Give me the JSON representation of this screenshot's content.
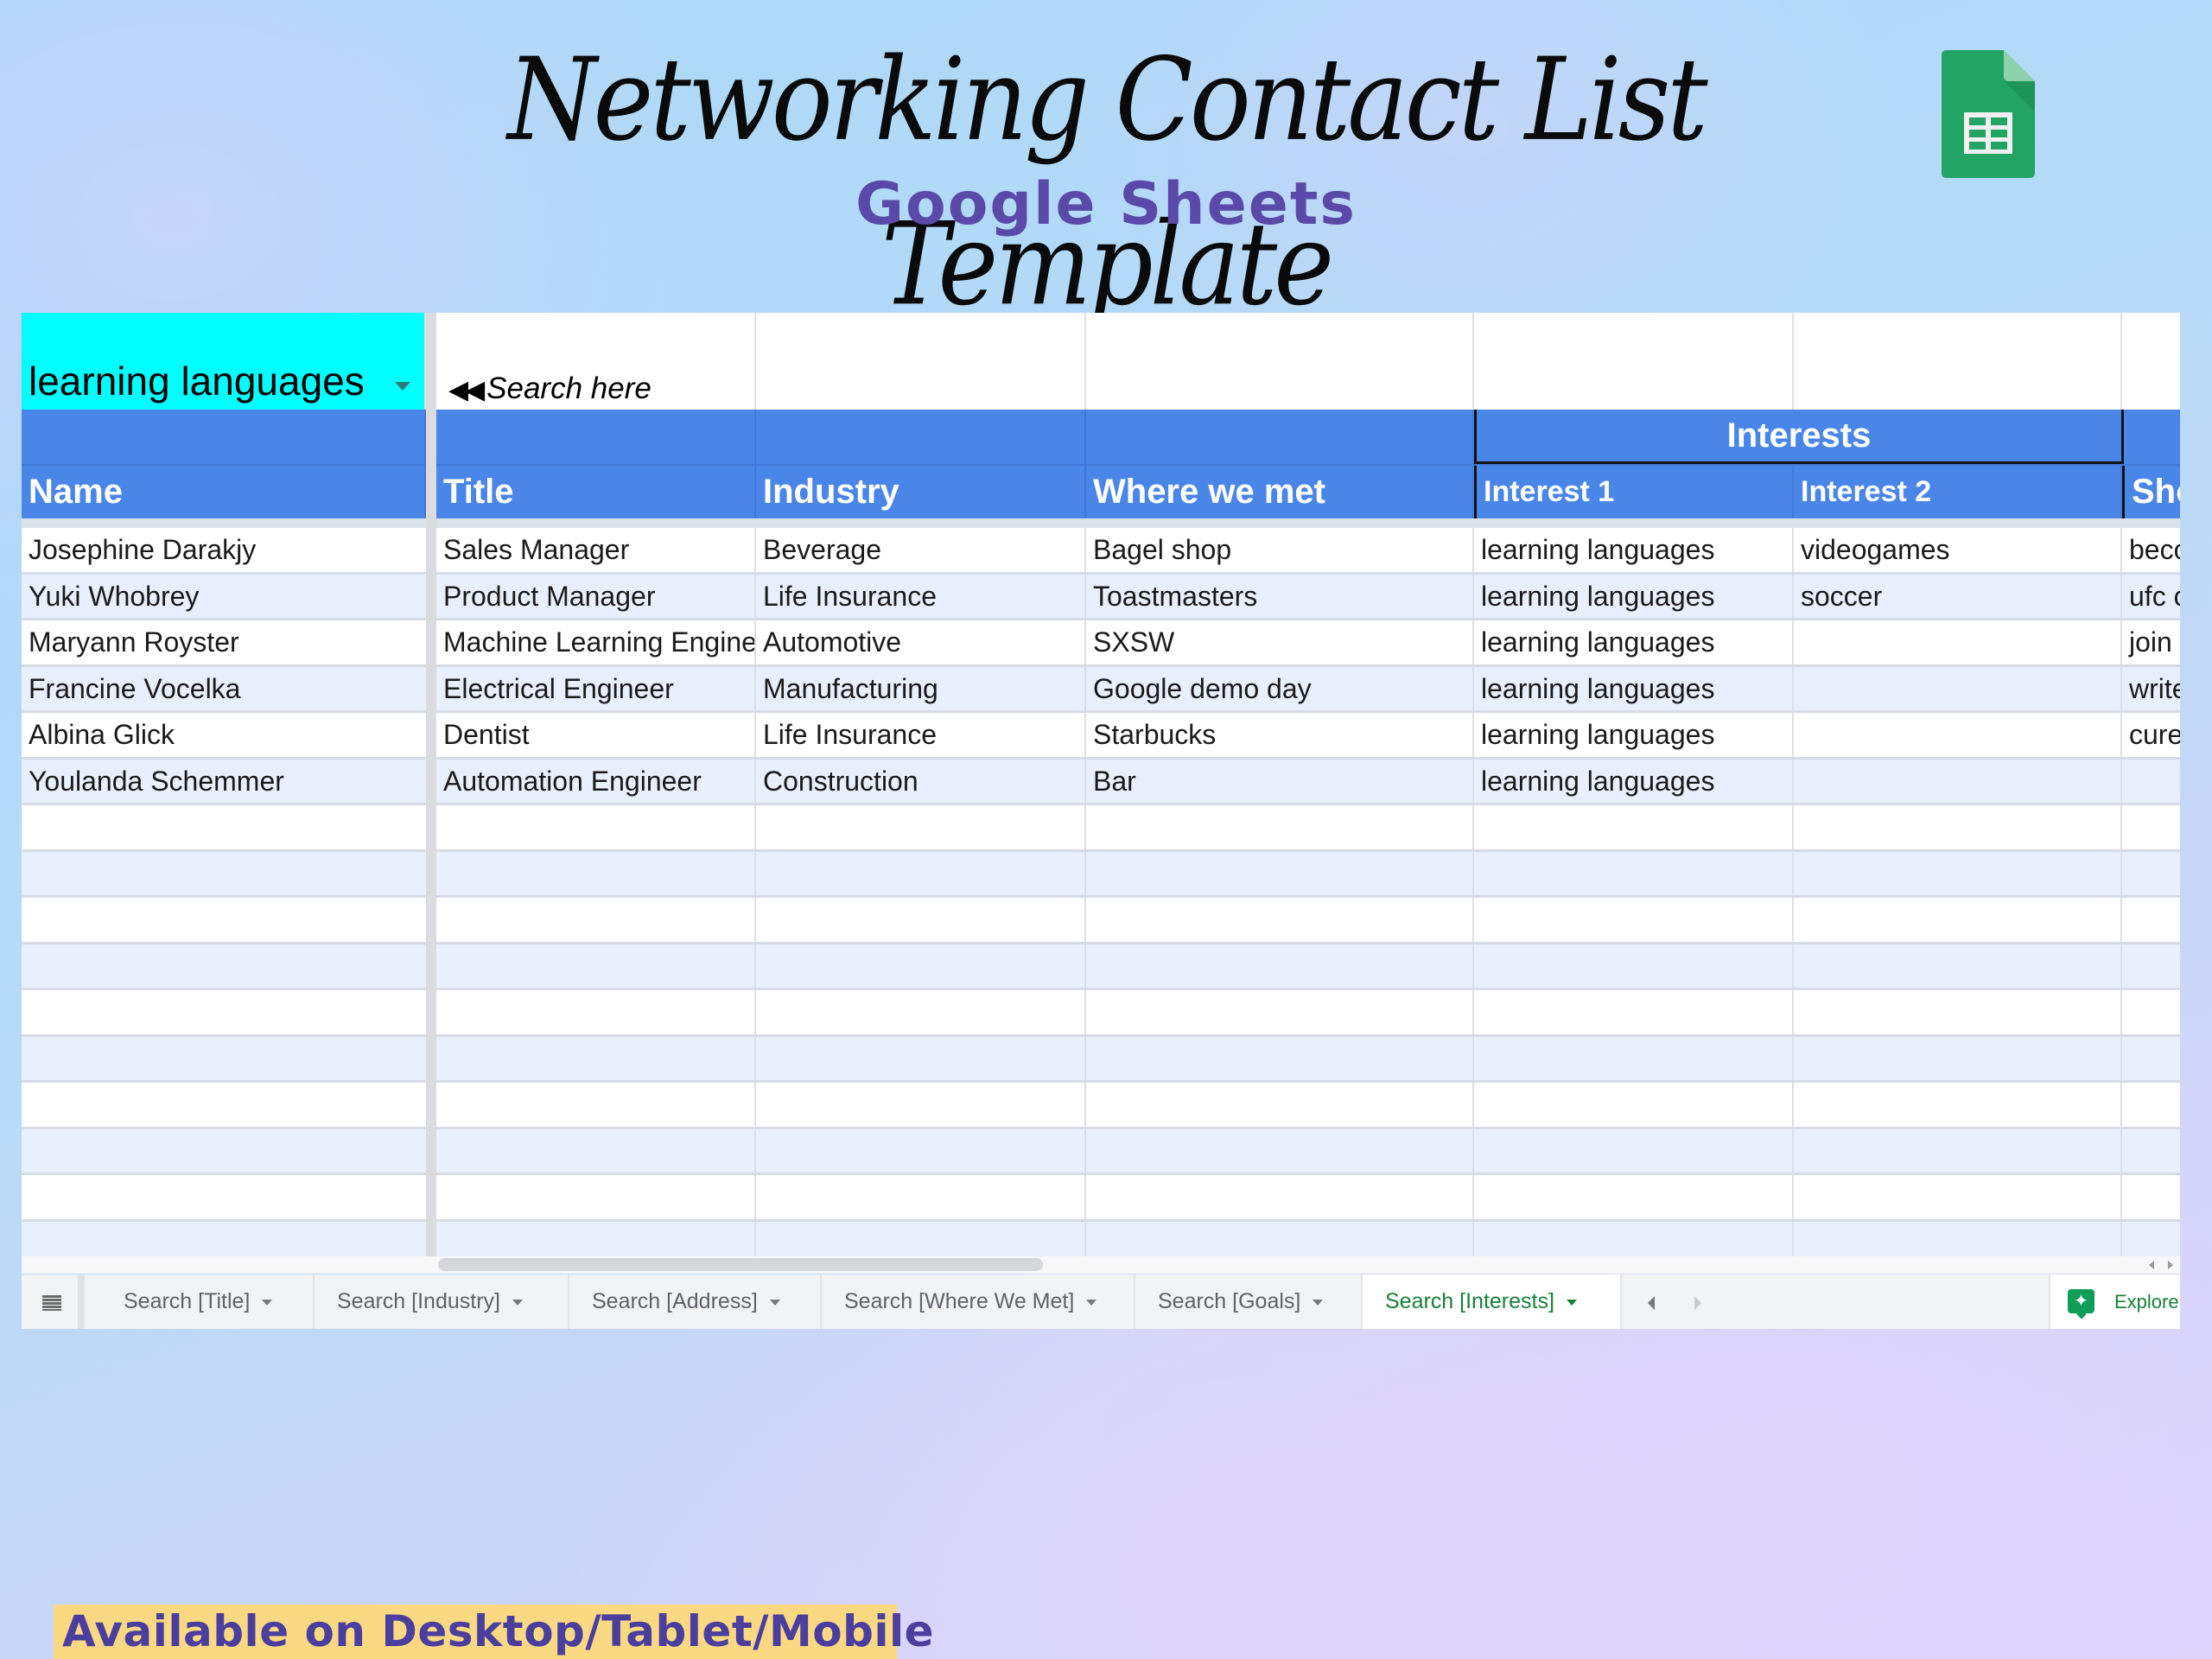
{
  "header": {
    "title": "Networking Contact List Template",
    "subtitle": "Google Sheets",
    "logo_icon": "google-sheets-icon"
  },
  "colors": {
    "filter_cell": "#00ffff",
    "header_blue": "#4a86e8",
    "band_light": "#e8f0fd",
    "active_tab_green": "#188038",
    "subtitle_purple": "#5a49a8",
    "banner_yellow": "#fbd982"
  },
  "filter": {
    "value": "learning languages",
    "hint_arrows": "◀◀",
    "hint": "Search here"
  },
  "table": {
    "group_header": "Interests",
    "columns": [
      "Name",
      "Title",
      "Industry",
      "Where we met",
      "Interest 1",
      "Interest 2",
      "Sho"
    ],
    "rows": [
      [
        "Josephine Darakjy",
        "Sales Manager",
        "Beverage",
        "Bagel shop",
        "learning languages",
        "videogames",
        "beco"
      ],
      [
        "Yuki Whobrey",
        "Product Manager",
        "Life Insurance",
        "Toastmasters",
        "learning languages",
        "soccer",
        "ufc c"
      ],
      [
        "Maryann Royster",
        "Machine Learning Engineer",
        "Automotive",
        "SXSW",
        "learning languages",
        "",
        "join a"
      ],
      [
        "Francine Vocelka",
        "Electrical Engineer",
        "Manufacturing",
        "Google demo day",
        "learning languages",
        "",
        "write"
      ],
      [
        "Albina Glick",
        "Dentist",
        "Life Insurance",
        "Starbucks",
        "learning languages",
        "",
        "cure"
      ],
      [
        "Youlanda Schemmer",
        "Automation Engineer",
        "Construction",
        "Bar",
        "learning languages",
        "",
        ""
      ],
      [
        "",
        "",
        "",
        "",
        "",
        "",
        ""
      ],
      [
        "",
        "",
        "",
        "",
        "",
        "",
        ""
      ],
      [
        "",
        "",
        "",
        "",
        "",
        "",
        ""
      ],
      [
        "",
        "",
        "",
        "",
        "",
        "",
        ""
      ],
      [
        "",
        "",
        "",
        "",
        "",
        "",
        ""
      ],
      [
        "",
        "",
        "",
        "",
        "",
        "",
        ""
      ],
      [
        "",
        "",
        "",
        "",
        "",
        "",
        ""
      ],
      [
        "",
        "",
        "",
        "",
        "",
        "",
        ""
      ],
      [
        "",
        "",
        "",
        "",
        "",
        "",
        ""
      ],
      [
        "",
        "",
        "",
        "",
        "",
        "",
        ""
      ]
    ]
  },
  "tabs": [
    {
      "label": "Search [Title]",
      "active": false
    },
    {
      "label": "Search [Industry]",
      "active": false
    },
    {
      "label": "Search [Address]",
      "active": false
    },
    {
      "label": "Search [Where We Met]",
      "active": false
    },
    {
      "label": "Search [Goals]",
      "active": false
    },
    {
      "label": "Search [Interests]",
      "active": true
    }
  ],
  "explore": {
    "label": "Explore"
  },
  "banner": {
    "text": "Available on Desktop/Tablet/Mobile"
  }
}
